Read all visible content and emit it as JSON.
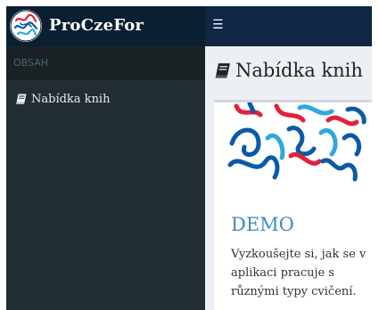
{
  "app": {
    "title": "ProCzeFor",
    "menu_icon": "hamburger-icon"
  },
  "sidebar": {
    "header": "OBSAH",
    "items": [
      {
        "label": "Nabídka knih",
        "icon": "book-icon"
      }
    ]
  },
  "main": {
    "title": "Nabídka knih",
    "title_icon": "book-icon",
    "cards": [
      {
        "title": "DEMO",
        "description": "Vyzkoušejte si, jak se v aplikaci pracuje s různými typy cvičení."
      }
    ]
  },
  "colors": {
    "topbar": "#0f2742",
    "brand": "#0b1f33",
    "sidebar": "#222d32",
    "content_bg": "#ecf0f5",
    "link": "#3c8dbc",
    "illustration_blue": "#0a5aa6",
    "illustration_red": "#e4203a",
    "illustration_cyan": "#2fa8de"
  }
}
